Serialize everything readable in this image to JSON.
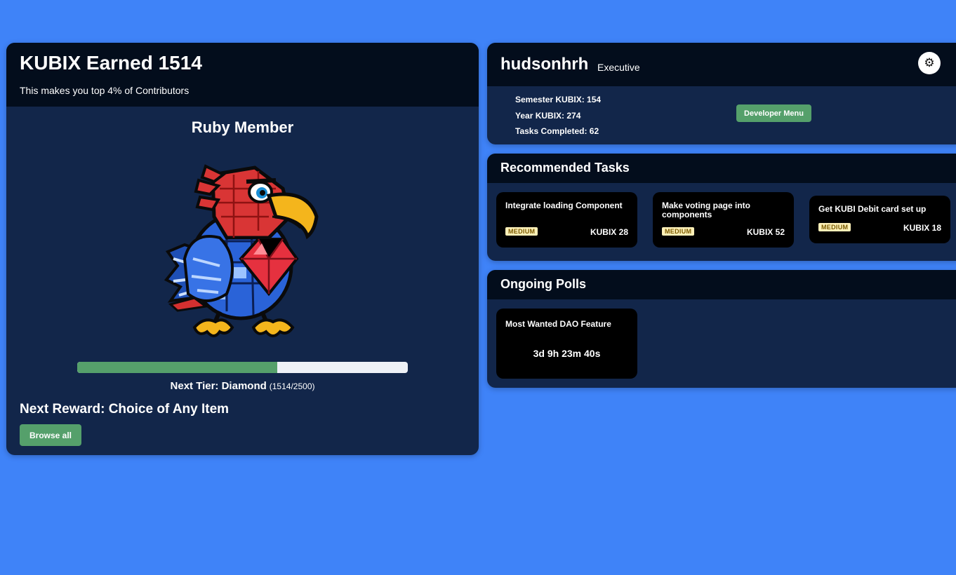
{
  "summary": {
    "title": "KUBIX Earned 1514",
    "subtitle": "This makes you top 4% of Contributors",
    "tier_title": "Ruby Member",
    "progress_fraction": 0.6056,
    "next_tier_label": "Next Tier: Diamond",
    "next_tier_count": "(1514/2500)",
    "next_reward": "Next Reward: Choice of Any Item",
    "browse_label": "Browse all"
  },
  "profile": {
    "username": "hudsonhrh",
    "role": "Executive",
    "semester": "Semester KUBIX: 154",
    "year": "Year KUBIX: 274",
    "tasks_completed": "Tasks Completed: 62",
    "developer_menu_label": "Developer Menu",
    "settings_icon": "gear-icon"
  },
  "tasks": {
    "heading": "Recommended Tasks",
    "items": [
      {
        "title": "Integrate loading Component",
        "difficulty": "MEDIUM",
        "reward": "KUBIX 28"
      },
      {
        "title": "Make voting page into components",
        "difficulty": "MEDIUM",
        "reward": "KUBIX 52"
      },
      {
        "title": "Get KUBI Debit card set up",
        "difficulty": "MEDIUM",
        "reward": "KUBIX 18"
      }
    ]
  },
  "polls": {
    "heading": "Ongoing Polls",
    "items": [
      {
        "title": "Most Wanted DAO Feature",
        "time_left": "3d 9h 23m 40s"
      }
    ]
  },
  "colors": {
    "background": "#3f83f8",
    "panel": "#12264a",
    "panel_header": "#030d1c",
    "accent_green": "#55a06b",
    "badge": "#fdf0b8"
  }
}
